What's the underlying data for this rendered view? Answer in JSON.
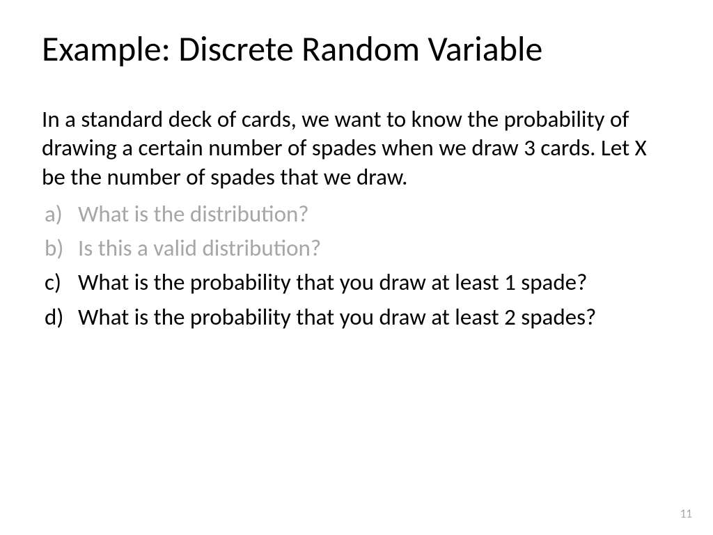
{
  "slide": {
    "title": "Example: Discrete Random Variable",
    "intro": "In a standard deck of cards, we want to know the probability of drawing a certain number of spades when we draw 3 cards. Let X be the number of spades that we draw.",
    "items": [
      {
        "marker": "a)",
        "text": "What is the distribution?",
        "faded": true
      },
      {
        "marker": "b)",
        "text": "Is this a valid distribution?",
        "faded": true
      },
      {
        "marker": "c)",
        "text": "What is the probability that you draw at least 1 spade?",
        "faded": false
      },
      {
        "marker": "d)",
        "text": "What is the probability that you draw at least 2 spades?",
        "faded": false
      }
    ],
    "page_number": "11"
  }
}
